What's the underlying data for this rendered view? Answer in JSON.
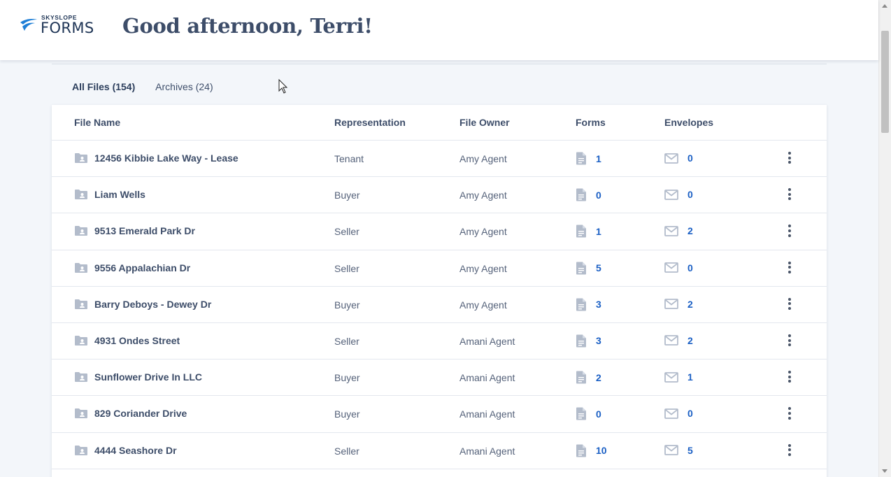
{
  "header": {
    "logo_top": "SKYSLOPE",
    "logo_main": "FORMS",
    "greeting": "Good afternoon, Terri!"
  },
  "tabs": [
    {
      "label": "All Files (154)",
      "active": true
    },
    {
      "label": "Archives (24)",
      "active": false
    }
  ],
  "table": {
    "columns": {
      "file_name": "File Name",
      "representation": "Representation",
      "file_owner": "File Owner",
      "forms": "Forms",
      "envelopes": "Envelopes"
    },
    "rows": [
      {
        "name": "12456 Kibbie Lake Way - Lease",
        "representation": "Tenant",
        "owner": "Amy Agent",
        "forms": "1",
        "envelopes": "0"
      },
      {
        "name": "Liam Wells",
        "representation": "Buyer",
        "owner": "Amy Agent",
        "forms": "0",
        "envelopes": "0"
      },
      {
        "name": "9513 Emerald Park Dr",
        "representation": "Seller",
        "owner": "Amy Agent",
        "forms": "1",
        "envelopes": "2"
      },
      {
        "name": "9556 Appalachian Dr",
        "representation": "Seller",
        "owner": "Amy Agent",
        "forms": "5",
        "envelopes": "0"
      },
      {
        "name": "Barry Deboys - Dewey Dr",
        "representation": "Buyer",
        "owner": "Amy Agent",
        "forms": "3",
        "envelopes": "2"
      },
      {
        "name": "4931 Ondes Street",
        "representation": "Seller",
        "owner": "Amani Agent",
        "forms": "3",
        "envelopes": "2"
      },
      {
        "name": "Sunflower Drive In LLC",
        "representation": "Buyer",
        "owner": "Amani Agent",
        "forms": "2",
        "envelopes": "1"
      },
      {
        "name": "829 Coriander Drive",
        "representation": "Buyer",
        "owner": "Amani Agent",
        "forms": "0",
        "envelopes": "0"
      },
      {
        "name": "4444 Seashore Dr",
        "representation": "Seller",
        "owner": "Amani Agent",
        "forms": "10",
        "envelopes": "5"
      }
    ]
  },
  "icons": {
    "row_folder": "folder-user-icon",
    "forms": "document-icon",
    "envelopes": "mail-icon",
    "more": "more-vertical-icon"
  },
  "colors": {
    "accent": "#1a5fc4",
    "heading": "#3d4d69",
    "background": "#f3f6fa",
    "icon": "#b3bccb"
  }
}
